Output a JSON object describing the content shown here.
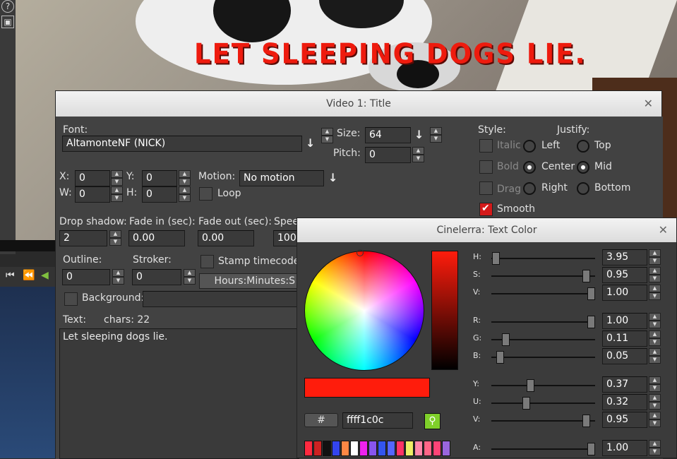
{
  "video": {
    "overlay_title": "LET SLEEPING DOGS LIE."
  },
  "left_strip": {
    "help_icon": "?",
    "frame_icon": "▣"
  },
  "title_window": {
    "title": "Video 1: Title",
    "font_label": "Font:",
    "font_value": "AltamonteNF (NICK)",
    "size_label": "Size:",
    "size_value": "64",
    "pitch_label": "Pitch:",
    "pitch_value": "0",
    "style_label": "Style:",
    "justify_label": "Justify:",
    "italic_label": "Italic",
    "bold_label": "Bold",
    "drag_label": "Drag",
    "smooth_label": "Smooth",
    "left_label": "Left",
    "center_label": "Center",
    "right_label": "Right",
    "top_label": "Top",
    "mid_label": "Mid",
    "bottom_label": "Bottom",
    "x_label": "X:",
    "x_value": "0",
    "y_label": "Y:",
    "y_value": "0",
    "w_label": "W:",
    "w_value": "0",
    "h_label": "H:",
    "h_value": "0",
    "motion_label": "Motion:",
    "motion_value": "No motion",
    "loop_label": "Loop",
    "drop_shadow_label": "Drop shadow:",
    "drop_shadow_value": "2",
    "fade_in_label": "Fade in (sec):",
    "fade_in_value": "0.00",
    "fade_out_label": "Fade out (sec):",
    "fade_out_value": "0.00",
    "speed_label": "Spee",
    "speed_value": "100.",
    "outline_label": "Outline:",
    "outline_value": "0",
    "stroker_label": "Stroker:",
    "stroker_value": "0",
    "stamp_label": "Stamp timecode",
    "timecode_format": "Hours:Minutes:S",
    "background_label": "Background:",
    "text_label": "Text:",
    "chars_label": "chars: 22",
    "text_value": "Let sleeping dogs lie."
  },
  "color_window": {
    "title": "Cinelerra: Text Color",
    "h_label": "H:",
    "h_value": "3.95",
    "s_label": "S:",
    "s_value": "0.95",
    "v_label": "V:",
    "v_value": "1.00",
    "r_label": "R:",
    "r_value": "1.00",
    "g_label": "G:",
    "g_value": "0.11",
    "b_label": "B:",
    "b_value": "0.05",
    "y_label": "Y:",
    "y_value": "0.37",
    "u_label": "U:",
    "u_value": "0.32",
    "v2_label": "V:",
    "v2_value": "0.95",
    "a_label": "A:",
    "a_value": "1.00",
    "hash_label": "#",
    "hex_value": "ffff1c0c",
    "current_color": "#ff1c0c",
    "slider_levels": {
      "h": 0.01,
      "s": 0.95,
      "v": 1.0,
      "r": 1.0,
      "g": 0.11,
      "b": 0.05,
      "y": 0.37,
      "u": 0.32,
      "v2": 0.95,
      "a": 1.0
    },
    "swatches": [
      "#ff2a40",
      "#cc2222",
      "#111111",
      "#3344ee",
      "#ff8844",
      "#ffffff",
      "#ee22ee",
      "#8855ee",
      "#3355ee",
      "#5566ff",
      "#ff3366",
      "#eeee66",
      "#ff88aa",
      "#ff6688",
      "#ff4477",
      "#9966dd"
    ]
  },
  "transport": {
    "rewind_icon": "⏮",
    "fast_back_icon": "⏪",
    "play_back_icon": "◀"
  }
}
